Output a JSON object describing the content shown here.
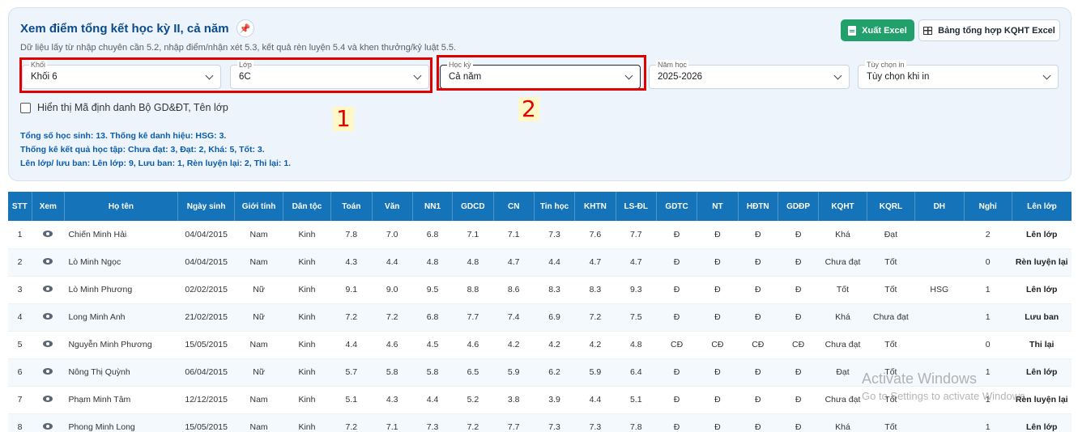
{
  "header": {
    "title": "Xem điểm tổng kết học kỳ II, cả năm",
    "pin_icon": "pin-icon",
    "subtitle": "Dữ liệu lấy từ nhập chuyên cần 5.2, nhập điểm/nhận xét 5.3, kết quả rèn luyện 5.4 và khen thưởng/kỷ luật 5.5.",
    "export_excel_label": "Xuất Excel",
    "kqht_excel_label": "Bảng tổng hợp KQHT Excel"
  },
  "filters": {
    "khoi": {
      "label": "Khối",
      "value": "Khối 6"
    },
    "lop": {
      "label": "Lớp",
      "value": "6C"
    },
    "hocky": {
      "label": "Học kỳ",
      "value": "Cả năm"
    },
    "namhoc": {
      "label": "Năm học",
      "value": "2025-2026"
    },
    "tuychon": {
      "label": "Tùy chọn in",
      "value": "Tùy chọn khi in"
    }
  },
  "annotations": {
    "one": "1",
    "two": "2"
  },
  "checkbox_label": "Hiển thị Mã định danh Bộ GD&ĐT, Tên lớp",
  "stats": {
    "line1": "Tổng số học sinh: 13. Thống kê danh hiệu: HSG: 3.",
    "line2": "Thống kê kết quả học tập: Chưa đạt: 3, Đạt: 2, Khá: 5, Tốt: 3.",
    "line3": "Lên lớp/ lưu ban: Lên lớp: 9, Lưu ban: 1, Rèn luyện lại: 2, Thi lại: 1."
  },
  "table": {
    "columns": [
      "STT",
      "Xem",
      "Họ tên",
      "Ngày sinh",
      "Giới tính",
      "Dân tộc",
      "Toán",
      "Văn",
      "NN1",
      "GDCD",
      "CN",
      "Tin học",
      "KHTN",
      "LS-ĐL",
      "GDTC",
      "NT",
      "HĐTN",
      "GDĐP",
      "KQHT",
      "KQRL",
      "DH",
      "Nghỉ",
      "Lên lớp"
    ],
    "rows": [
      [
        "1",
        "",
        "Chiến Minh Hải",
        "04/04/2015",
        "Nam",
        "Kinh",
        "7.8",
        "7.0",
        "6.8",
        "7.1",
        "7.1",
        "7.3",
        "7.6",
        "7.7",
        "Đ",
        "Đ",
        "Đ",
        "Đ",
        "Khá",
        "Đạt",
        "",
        "2",
        "Lên lớp"
      ],
      [
        "2",
        "",
        "Lò Minh Ngọc",
        "04/04/2015",
        "Nam",
        "Kinh",
        "4.3",
        "4.4",
        "4.8",
        "4.8",
        "4.7",
        "4.4",
        "4.7",
        "4.7",
        "Đ",
        "Đ",
        "Đ",
        "Đ",
        "Chưa đạt",
        "Tốt",
        "",
        "0",
        "Rèn luyện lại"
      ],
      [
        "3",
        "",
        "Lò Minh Phương",
        "02/02/2015",
        "Nữ",
        "Kinh",
        "9.1",
        "9.0",
        "9.5",
        "8.8",
        "8.6",
        "8.3",
        "8.3",
        "9.3",
        "Đ",
        "Đ",
        "Đ",
        "Đ",
        "Tốt",
        "Tốt",
        "HSG",
        "1",
        "Lên lớp"
      ],
      [
        "4",
        "",
        "Long Minh Anh",
        "21/02/2015",
        "Nữ",
        "Kinh",
        "7.2",
        "7.2",
        "6.8",
        "7.7",
        "7.4",
        "6.9",
        "7.2",
        "7.5",
        "Đ",
        "Đ",
        "Đ",
        "Đ",
        "Khá",
        "Chưa đạt",
        "",
        "1",
        "Lưu ban"
      ],
      [
        "5",
        "",
        "Nguyễn Minh Phương",
        "15/05/2015",
        "Nam",
        "Kinh",
        "4.4",
        "4.6",
        "4.5",
        "4.6",
        "4.2",
        "4.2",
        "4.2",
        "4.8",
        "CĐ",
        "CĐ",
        "CĐ",
        "CĐ",
        "Chưa đạt",
        "Tốt",
        "",
        "0",
        "Thi lại"
      ],
      [
        "6",
        "",
        "Nông Thị Quỳnh",
        "06/04/2015",
        "Nữ",
        "Kinh",
        "5.7",
        "5.8",
        "5.8",
        "6.5",
        "5.9",
        "6.2",
        "5.9",
        "6.4",
        "Đ",
        "Đ",
        "Đ",
        "Đ",
        "Đạt",
        "Tốt",
        "",
        "1",
        "Lên lớp"
      ],
      [
        "7",
        "",
        "Phạm Minh Tâm",
        "12/12/2015",
        "Nam",
        "Kinh",
        "5.1",
        "4.3",
        "4.4",
        "5.2",
        "3.8",
        "3.9",
        "4.4",
        "5.1",
        "Đ",
        "Đ",
        "Đ",
        "Đ",
        "Chưa đạt",
        "Tốt",
        "",
        "1",
        "Rèn luyện lại"
      ],
      [
        "8",
        "",
        "Phong Minh Long",
        "15/05/2015",
        "Nam",
        "Kinh",
        "7.2",
        "7.1",
        "7.3",
        "7.2",
        "7.7",
        "7.3",
        "7.3",
        "7.8",
        "Đ",
        "Đ",
        "Đ",
        "Đ",
        "Khá",
        "Tốt",
        "",
        "1",
        "Lên lớp"
      ]
    ]
  },
  "watermark": {
    "line1": "Activate Windows",
    "line2": "Go to Settings to activate Windows."
  }
}
